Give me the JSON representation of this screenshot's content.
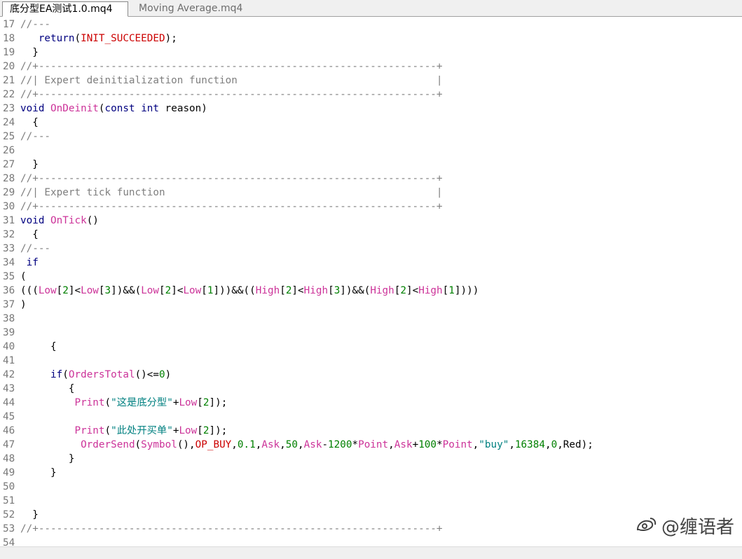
{
  "tabs": [
    {
      "label": "底分型EA测试1.0.mq4",
      "active": true
    },
    {
      "label": "Moving Average.mq4",
      "active": false
    }
  ],
  "lines": [
    {
      "n": "17",
      "tokens": [
        {
          "t": "//---",
          "c": "comment"
        }
      ]
    },
    {
      "n": "18",
      "tokens": [
        {
          "t": "   ",
          "c": "sym"
        },
        {
          "t": "return",
          "c": "kw"
        },
        {
          "t": "(",
          "c": "sym"
        },
        {
          "t": "INIT_SUCCEEDED",
          "c": "const"
        },
        {
          "t": ");",
          "c": "sym"
        }
      ]
    },
    {
      "n": "19",
      "tokens": [
        {
          "t": "  }",
          "c": "sym"
        }
      ]
    },
    {
      "n": "20",
      "tokens": [
        {
          "t": "//+------------------------------------------------------------------+",
          "c": "comment"
        }
      ]
    },
    {
      "n": "21",
      "tokens": [
        {
          "t": "//| Expert deinitialization function                                 |",
          "c": "comment"
        }
      ]
    },
    {
      "n": "22",
      "tokens": [
        {
          "t": "//+------------------------------------------------------------------+",
          "c": "comment"
        }
      ]
    },
    {
      "n": "23",
      "tokens": [
        {
          "t": "void",
          "c": "kw"
        },
        {
          "t": " ",
          "c": "sym"
        },
        {
          "t": "OnDeinit",
          "c": "fn"
        },
        {
          "t": "(",
          "c": "sym"
        },
        {
          "t": "const",
          "c": "kw"
        },
        {
          "t": " ",
          "c": "sym"
        },
        {
          "t": "int",
          "c": "kw"
        },
        {
          "t": " reason)",
          "c": "sym"
        }
      ]
    },
    {
      "n": "24",
      "tokens": [
        {
          "t": "  {",
          "c": "sym"
        }
      ]
    },
    {
      "n": "25",
      "tokens": [
        {
          "t": "//---",
          "c": "comment"
        }
      ]
    },
    {
      "n": "26",
      "tokens": []
    },
    {
      "n": "27",
      "tokens": [
        {
          "t": "  }",
          "c": "sym"
        }
      ]
    },
    {
      "n": "28",
      "tokens": [
        {
          "t": "//+------------------------------------------------------------------+",
          "c": "comment"
        }
      ]
    },
    {
      "n": "29",
      "tokens": [
        {
          "t": "//| Expert tick function                                             |",
          "c": "comment"
        }
      ]
    },
    {
      "n": "30",
      "tokens": [
        {
          "t": "//+------------------------------------------------------------------+",
          "c": "comment"
        }
      ]
    },
    {
      "n": "31",
      "tokens": [
        {
          "t": "void",
          "c": "kw"
        },
        {
          "t": " ",
          "c": "sym"
        },
        {
          "t": "OnTick",
          "c": "fn"
        },
        {
          "t": "()",
          "c": "sym"
        }
      ]
    },
    {
      "n": "32",
      "tokens": [
        {
          "t": "  {",
          "c": "sym"
        }
      ]
    },
    {
      "n": "33",
      "tokens": [
        {
          "t": "//---",
          "c": "comment"
        }
      ]
    },
    {
      "n": "34",
      "tokens": [
        {
          "t": " ",
          "c": "sym"
        },
        {
          "t": "if",
          "c": "kw"
        }
      ]
    },
    {
      "n": "35",
      "tokens": [
        {
          "t": "(",
          "c": "sym"
        }
      ]
    },
    {
      "n": "36",
      "tokens": [
        {
          "t": "(((",
          "c": "sym"
        },
        {
          "t": "Low",
          "c": "fn"
        },
        {
          "t": "[",
          "c": "sym"
        },
        {
          "t": "2",
          "c": "num"
        },
        {
          "t": "]<",
          "c": "sym"
        },
        {
          "t": "Low",
          "c": "fn"
        },
        {
          "t": "[",
          "c": "sym"
        },
        {
          "t": "3",
          "c": "num"
        },
        {
          "t": "])&&(",
          "c": "sym"
        },
        {
          "t": "Low",
          "c": "fn"
        },
        {
          "t": "[",
          "c": "sym"
        },
        {
          "t": "2",
          "c": "num"
        },
        {
          "t": "]<",
          "c": "sym"
        },
        {
          "t": "Low",
          "c": "fn"
        },
        {
          "t": "[",
          "c": "sym"
        },
        {
          "t": "1",
          "c": "num"
        },
        {
          "t": "]))&&((",
          "c": "sym"
        },
        {
          "t": "High",
          "c": "fn"
        },
        {
          "t": "[",
          "c": "sym"
        },
        {
          "t": "2",
          "c": "num"
        },
        {
          "t": "]<",
          "c": "sym"
        },
        {
          "t": "High",
          "c": "fn"
        },
        {
          "t": "[",
          "c": "sym"
        },
        {
          "t": "3",
          "c": "num"
        },
        {
          "t": "])&&(",
          "c": "sym"
        },
        {
          "t": "High",
          "c": "fn"
        },
        {
          "t": "[",
          "c": "sym"
        },
        {
          "t": "2",
          "c": "num"
        },
        {
          "t": "]<",
          "c": "sym"
        },
        {
          "t": "High",
          "c": "fn"
        },
        {
          "t": "[",
          "c": "sym"
        },
        {
          "t": "1",
          "c": "num"
        },
        {
          "t": "])))",
          "c": "sym"
        }
      ]
    },
    {
      "n": "37",
      "tokens": [
        {
          "t": ")",
          "c": "sym"
        }
      ]
    },
    {
      "n": "38",
      "tokens": []
    },
    {
      "n": "39",
      "tokens": []
    },
    {
      "n": "40",
      "tokens": [
        {
          "t": "     {",
          "c": "sym"
        }
      ]
    },
    {
      "n": "41",
      "tokens": []
    },
    {
      "n": "42",
      "tokens": [
        {
          "t": "     ",
          "c": "sym"
        },
        {
          "t": "if",
          "c": "kw"
        },
        {
          "t": "(",
          "c": "sym"
        },
        {
          "t": "OrdersTotal",
          "c": "fn"
        },
        {
          "t": "()<=",
          "c": "sym"
        },
        {
          "t": "0",
          "c": "num"
        },
        {
          "t": ")",
          "c": "sym"
        }
      ]
    },
    {
      "n": "43",
      "tokens": [
        {
          "t": "        {",
          "c": "sym"
        }
      ]
    },
    {
      "n": "44",
      "tokens": [
        {
          "t": "         ",
          "c": "sym"
        },
        {
          "t": "Print",
          "c": "fn"
        },
        {
          "t": "(",
          "c": "sym"
        },
        {
          "t": "\"这是底分型\"",
          "c": "str"
        },
        {
          "t": "+",
          "c": "sym"
        },
        {
          "t": "Low",
          "c": "fn"
        },
        {
          "t": "[",
          "c": "sym"
        },
        {
          "t": "2",
          "c": "num"
        },
        {
          "t": "]);",
          "c": "sym"
        }
      ]
    },
    {
      "n": "45",
      "tokens": []
    },
    {
      "n": "46",
      "tokens": [
        {
          "t": "         ",
          "c": "sym"
        },
        {
          "t": "Print",
          "c": "fn"
        },
        {
          "t": "(",
          "c": "sym"
        },
        {
          "t": "\"此处开买单\"",
          "c": "str"
        },
        {
          "t": "+",
          "c": "sym"
        },
        {
          "t": "Low",
          "c": "fn"
        },
        {
          "t": "[",
          "c": "sym"
        },
        {
          "t": "2",
          "c": "num"
        },
        {
          "t": "]);",
          "c": "sym"
        }
      ]
    },
    {
      "n": "47",
      "tokens": [
        {
          "t": "          ",
          "c": "sym"
        },
        {
          "t": "OrderSend",
          "c": "fn"
        },
        {
          "t": "(",
          "c": "sym"
        },
        {
          "t": "Symbol",
          "c": "fn"
        },
        {
          "t": "(),",
          "c": "sym"
        },
        {
          "t": "OP_BUY",
          "c": "const"
        },
        {
          "t": ",",
          "c": "sym"
        },
        {
          "t": "0.1",
          "c": "num"
        },
        {
          "t": ",",
          "c": "sym"
        },
        {
          "t": "Ask",
          "c": "fn"
        },
        {
          "t": ",",
          "c": "sym"
        },
        {
          "t": "50",
          "c": "num"
        },
        {
          "t": ",",
          "c": "sym"
        },
        {
          "t": "Ask",
          "c": "fn"
        },
        {
          "t": "-",
          "c": "sym"
        },
        {
          "t": "1200",
          "c": "num"
        },
        {
          "t": "*",
          "c": "sym"
        },
        {
          "t": "Point",
          "c": "fn"
        },
        {
          "t": ",",
          "c": "sym"
        },
        {
          "t": "Ask",
          "c": "fn"
        },
        {
          "t": "+",
          "c": "sym"
        },
        {
          "t": "100",
          "c": "num"
        },
        {
          "t": "*",
          "c": "sym"
        },
        {
          "t": "Point",
          "c": "fn"
        },
        {
          "t": ",",
          "c": "sym"
        },
        {
          "t": "\"buy\"",
          "c": "str"
        },
        {
          "t": ",",
          "c": "sym"
        },
        {
          "t": "16384",
          "c": "num"
        },
        {
          "t": ",",
          "c": "sym"
        },
        {
          "t": "0",
          "c": "num"
        },
        {
          "t": ",Red);",
          "c": "sym"
        }
      ]
    },
    {
      "n": "48",
      "tokens": [
        {
          "t": "        }",
          "c": "sym"
        }
      ]
    },
    {
      "n": "49",
      "tokens": [
        {
          "t": "     }",
          "c": "sym"
        }
      ]
    },
    {
      "n": "50",
      "tokens": []
    },
    {
      "n": "51",
      "tokens": []
    },
    {
      "n": "52",
      "tokens": [
        {
          "t": "  }",
          "c": "sym"
        }
      ]
    },
    {
      "n": "53",
      "tokens": [
        {
          "t": "//+------------------------------------------------------------------+",
          "c": "comment"
        }
      ]
    },
    {
      "n": "54",
      "tokens": []
    }
  ],
  "watermark": {
    "text": "@缠语者"
  },
  "colors": {
    "keyword": "#000080",
    "function": "#cc3399",
    "constant": "#cc0000",
    "number": "#008000",
    "string": "#008080",
    "comment": "#7f7f7f",
    "line_number": "#787878"
  }
}
